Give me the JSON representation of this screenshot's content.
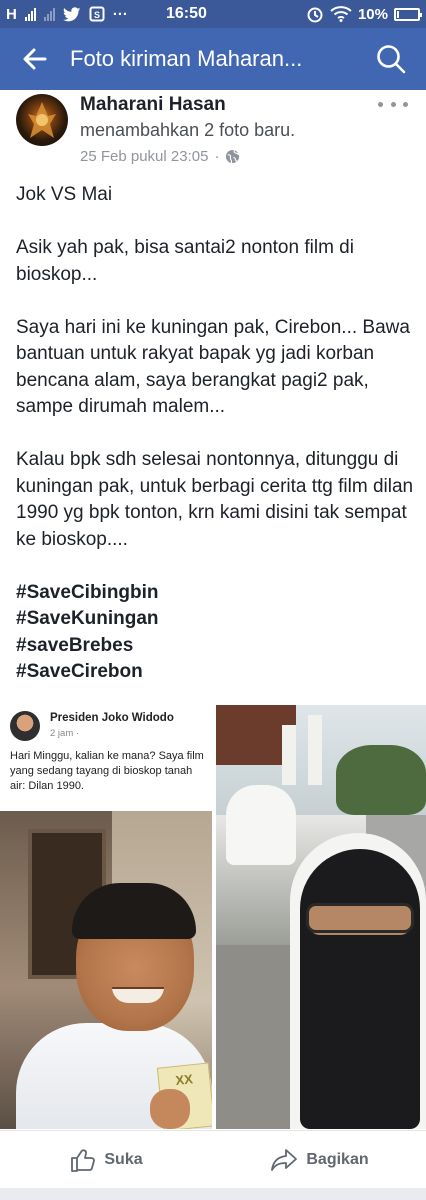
{
  "status_bar": {
    "carrier_label": "H",
    "time": "16:50",
    "more_indicator": "···",
    "battery_text": "10%",
    "battery_level": 0.1
  },
  "app_bar": {
    "title": "Foto kiriman Maharan...",
    "back_icon": "arrow-left-icon",
    "search_icon": "search-icon"
  },
  "post": {
    "author": "Maharani Hasan",
    "action": "menambahkan 2 foto baru.",
    "timestamp": "25 Feb pukul 23:05",
    "separator": "·",
    "privacy_icon": "globe-icon",
    "more_icon": "more-options-icon",
    "paragraphs": [
      "Jok VS Mai",
      "Asik yah pak, bisa santai2 nonton film di bioskop...",
      "Saya hari ini ke kuningan pak, Cirebon... Bawa bantuan untuk rakyat bapak yg jadi korban bencana alam, saya berangkat pagi2 pak, sampe dirumah malem...",
      "Kalau bpk sdh selesai nontonnya, ditunggu di kuningan pak, untuk berbagi cerita ttg film dilan 1990 yg bpk tonton, krn kami disini tak sempat ke bioskop...."
    ],
    "hashtags": [
      "#SaveCibingbin",
      "#SaveKuningan",
      "#saveBrebes",
      "#SaveCirebon"
    ]
  },
  "photos": {
    "left": {
      "embed_name": "Presiden Joko Widodo",
      "embed_time": "2 jam ·",
      "embed_text": "Hari Minggu, kalian ke mana? Saya film yang sedang tayang di bioskop tanah air: Dilan 1990.",
      "ticket_text": "XX"
    }
  },
  "actions": {
    "like_label": "Suka",
    "like_icon": "thumbs-up-icon",
    "share_label": "Bagikan",
    "share_icon": "share-arrow-icon"
  }
}
